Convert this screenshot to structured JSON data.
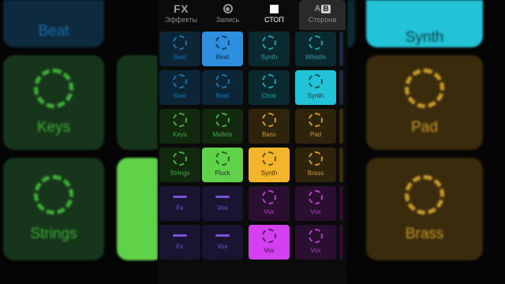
{
  "toolbar": {
    "fx": {
      "glyph": "FX",
      "label": "Эффекты"
    },
    "record": {
      "label": "Запись"
    },
    "stop": {
      "label": "СТОП"
    },
    "side": {
      "glyph_a": "A",
      "glyph_b": "B",
      "label": "Сторона"
    }
  },
  "pads": [
    [
      {
        "label": "Beat",
        "type": "ring",
        "color": "#1a6fb0",
        "bg": "#0c2638",
        "lit": false
      },
      {
        "label": "Beat",
        "type": "ring",
        "color": "#0c2a4a",
        "bg": "#2e8fe0",
        "lit": true
      },
      {
        "label": "Synth",
        "type": "ring",
        "color": "#1fa0b0",
        "bg": "#0b2a30",
        "lit": false
      },
      {
        "label": "Whistle",
        "type": "ring",
        "color": "#1fa0b0",
        "bg": "#0b2a30",
        "lit": false
      }
    ],
    [
      {
        "label": "Beat",
        "type": "ring",
        "color": "#1a6fb0",
        "bg": "#0c2638",
        "lit": false
      },
      {
        "label": "Beat",
        "type": "ring",
        "color": "#1a6fb0",
        "bg": "#0c2638",
        "lit": false
      },
      {
        "label": "Choir",
        "type": "ring",
        "color": "#1fa0b0",
        "bg": "#0b2a30",
        "lit": false
      },
      {
        "label": "Synth",
        "type": "ring",
        "color": "#0c3a40",
        "bg": "#22c3d6",
        "lit": true
      }
    ],
    [
      {
        "label": "Keys",
        "type": "ring",
        "color": "#3fae3a",
        "bg": "#12280f",
        "lit": false
      },
      {
        "label": "Mallets",
        "type": "ring",
        "color": "#3fae3a",
        "bg": "#12280f",
        "lit": false
      },
      {
        "label": "Bass",
        "type": "ring",
        "color": "#c99a2a",
        "bg": "#2e230b",
        "lit": false
      },
      {
        "label": "Pad",
        "type": "ring",
        "color": "#c99a2a",
        "bg": "#2e230b",
        "lit": false
      }
    ],
    [
      {
        "label": "Strings",
        "type": "ring",
        "color": "#3fae3a",
        "bg": "#12280f",
        "lit": false
      },
      {
        "label": "Pluck",
        "type": "ring",
        "color": "#173d12",
        "bg": "#5fd24a",
        "lit": true
      },
      {
        "label": "Synth",
        "type": "ring",
        "color": "#3d2e07",
        "bg": "#f2b52c",
        "lit": true
      },
      {
        "label": "Brass",
        "type": "ring",
        "color": "#c99a2a",
        "bg": "#2e230b",
        "lit": false
      }
    ],
    [
      {
        "label": "Fx",
        "type": "dash",
        "color": "#7a55d8",
        "bg": "#1a1433",
        "lit": false
      },
      {
        "label": "Vox",
        "type": "dash",
        "color": "#7a55d8",
        "bg": "#1a1433",
        "lit": false
      },
      {
        "label": "Vox",
        "type": "ring",
        "color": "#b13fc4",
        "bg": "#2a0f30",
        "lit": false
      },
      {
        "label": "Vox",
        "type": "ring",
        "color": "#b13fc4",
        "bg": "#2a0f30",
        "lit": false
      }
    ],
    [
      {
        "label": "Fx",
        "type": "dash",
        "color": "#7a55d8",
        "bg": "#1a1433",
        "lit": false
      },
      {
        "label": "Vox",
        "type": "dash",
        "color": "#7a55d8",
        "bg": "#1a1433",
        "lit": false
      },
      {
        "label": "Vox",
        "type": "ring",
        "color": "#3a0c44",
        "bg": "#d43ff0",
        "lit": true
      },
      {
        "label": "Vox",
        "type": "ring",
        "color": "#b13fc4",
        "bg": "#2a0f30",
        "lit": false
      }
    ]
  ],
  "background": {
    "left": [
      {
        "label": "Beat",
        "color": "#1a6fb0",
        "bg": "#0d2a3f"
      },
      {
        "label": "Keys",
        "color": "#3fae3a",
        "bg": "#17351a"
      },
      {
        "label": "Strings",
        "color": "#3fae3a",
        "bg": "#17351a"
      }
    ],
    "right": [
      {
        "label": "Synth",
        "color": "#0c3a40",
        "bg": "#22c3d6"
      },
      {
        "label": "Pad",
        "color": "#c99a2a",
        "bg": "#3a2b0c"
      },
      {
        "label": "Brass",
        "color": "#c99a2a",
        "bg": "#3a2b0c"
      }
    ]
  }
}
